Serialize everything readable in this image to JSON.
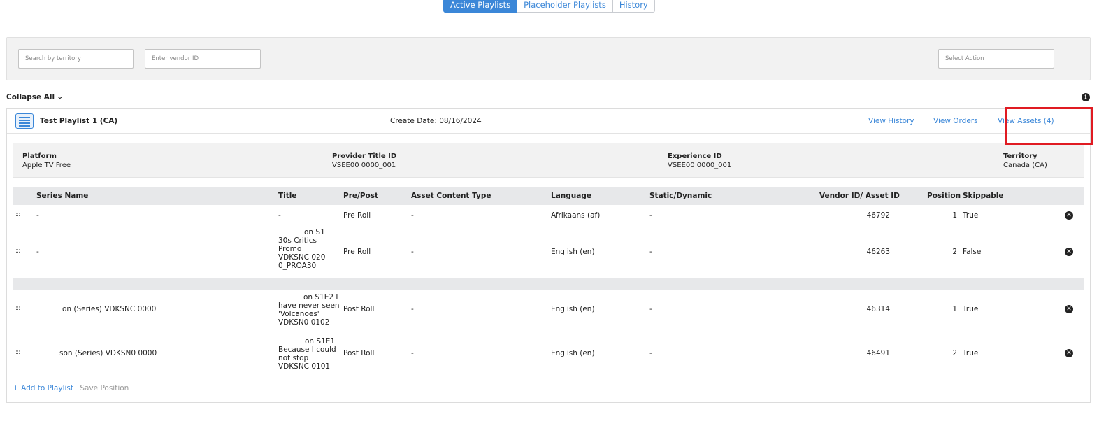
{
  "tabs": [
    {
      "label": "Active Playlists",
      "active": true
    },
    {
      "label": "Placeholder Playlists",
      "active": false
    },
    {
      "label": "History",
      "active": false
    }
  ],
  "filters": {
    "territory_placeholder": "Search by territory",
    "vendor_placeholder": "Enter vendor ID",
    "action_placeholder": "Select Action"
  },
  "collapse_label": "Collapse All",
  "playlist": {
    "name": "Test Playlist 1 (CA)",
    "create_date": "Create Date: 08/16/2024",
    "links": {
      "history": "View History",
      "orders": "View Orders",
      "assets": "View Assets (4)"
    },
    "info": {
      "platform_label": "Platform",
      "platform_value": "Apple TV Free",
      "provider_label": "Provider Title ID",
      "provider_value": "VSEE00   0000_001",
      "experience_label": "Experience ID",
      "experience_value": "VSEE00   0000_001",
      "territory_label": "Territory",
      "territory_value": "Canada (CA)"
    },
    "columns": {
      "series": "Series Name",
      "title": "Title",
      "prepost": "Pre/Post",
      "act": "Asset Content Type",
      "language": "Language",
      "static": "Static/Dynamic",
      "vendor": "Vendor ID/ Asset ID",
      "position": "Position",
      "skippable": "Skippable"
    },
    "rows": [
      {
        "series": "-",
        "title": [
          "-"
        ],
        "prepost": "Pre Roll",
        "act": "-",
        "language": "Afrikaans (af)",
        "static": "-",
        "vendor": "46792",
        "position": "1",
        "skippable": "True"
      },
      {
        "series": "-",
        "title": [
          "on S1",
          "30s Critics",
          "Promo",
          "VDKSNC    020",
          "0_PROA30"
        ],
        "prepost": "Pre Roll",
        "act": "-",
        "language": "English (en)",
        "static": "-",
        "vendor": "46263",
        "position": "2",
        "skippable": "False"
      },
      {
        "series": "on (Series) VDKSNC  0000",
        "title": [
          "on S1E2 I",
          "have never seen",
          "'Volcanoes'",
          "VDKSN0    0102"
        ],
        "prepost": "Post Roll",
        "act": "-",
        "language": "English (en)",
        "static": "-",
        "vendor": "46314",
        "position": "1",
        "skippable": "True"
      },
      {
        "series": "son (Series) VDKSN0     0000",
        "title": [
          "on S1E1",
          "Because I could",
          "not stop",
          "VDKSNC    0101"
        ],
        "prepost": "Post Roll",
        "act": "-",
        "language": "English (en)",
        "static": "-",
        "vendor": "46491",
        "position": "2",
        "skippable": "True"
      }
    ],
    "add_label": "+ Add to Playlist",
    "save_label": "Save Position"
  }
}
